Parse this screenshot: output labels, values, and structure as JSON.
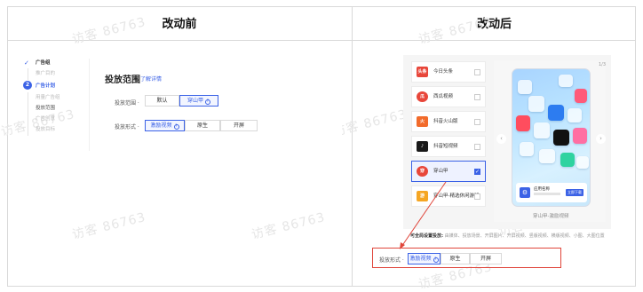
{
  "header": {
    "before_title": "改动前",
    "after_title": "改动后"
  },
  "watermark": "访客 86763",
  "left": {
    "steps": [
      {
        "label": "广告组",
        "state": "done"
      },
      {
        "label": "推广目的",
        "state": "sub"
      },
      {
        "label": "广告计划",
        "state": "current",
        "num": "2"
      },
      {
        "label": "用量广告组",
        "state": "sub"
      },
      {
        "label": "投放范围",
        "state": "sub-active"
      },
      {
        "label": "广告创意",
        "state": "sub"
      },
      {
        "label": "投放目标",
        "state": "sub"
      }
    ],
    "panel_title": "投放范围",
    "panel_link": "了解详情",
    "row1": {
      "label": "投放范围 ·",
      "options": [
        {
          "label": "默认",
          "selected": false
        },
        {
          "label": "穿山甲",
          "selected": true,
          "help": true
        }
      ]
    },
    "row2": {
      "label": "投放形式 ·",
      "options": [
        {
          "label": "激励视频",
          "selected": true,
          "help": true
        },
        {
          "label": "原生",
          "selected": false
        },
        {
          "label": "开屏",
          "selected": false
        }
      ]
    }
  },
  "right": {
    "media": [
      {
        "label": "今日头条",
        "icon": "头条",
        "color": "#e8463a",
        "selected": false
      },
      {
        "label": "西瓜视频",
        "icon": "瓜",
        "color": "#e8463a",
        "selected": false
      },
      {
        "label": "抖音火山版",
        "icon": "火",
        "color": "#f26b2b",
        "selected": false
      },
      {
        "label": "抖音短视频",
        "icon": "♪",
        "color": "#1a1a1a",
        "selected": false
      },
      {
        "label": "穿山甲",
        "icon": "穿",
        "color": "#e8463a",
        "selected": true
      },
      {
        "label": "穿山甲-精选休闲游戏",
        "icon": "游",
        "color": "#f5a623",
        "selected": false
      }
    ],
    "preview_page": "1/3",
    "preview_caption": "穿山甲-激励视频",
    "app_card": {
      "name": "应用名称",
      "button": "立即下载"
    },
    "hint_bold": "可全局设置投放:",
    "hint_text": "由媒体、投放场景、开屏图片、开屏视频、竖版视频、横版视频、小图、大图位置",
    "bottom_row": {
      "label": "投放形式 ·",
      "options": [
        {
          "label": "激励视频",
          "selected": true,
          "help": true
        },
        {
          "label": "原生",
          "selected": false
        },
        {
          "label": "开屏",
          "selected": false
        }
      ]
    }
  },
  "colors": {
    "accent": "#3b62e6",
    "highlight_red": "#e0453a"
  }
}
